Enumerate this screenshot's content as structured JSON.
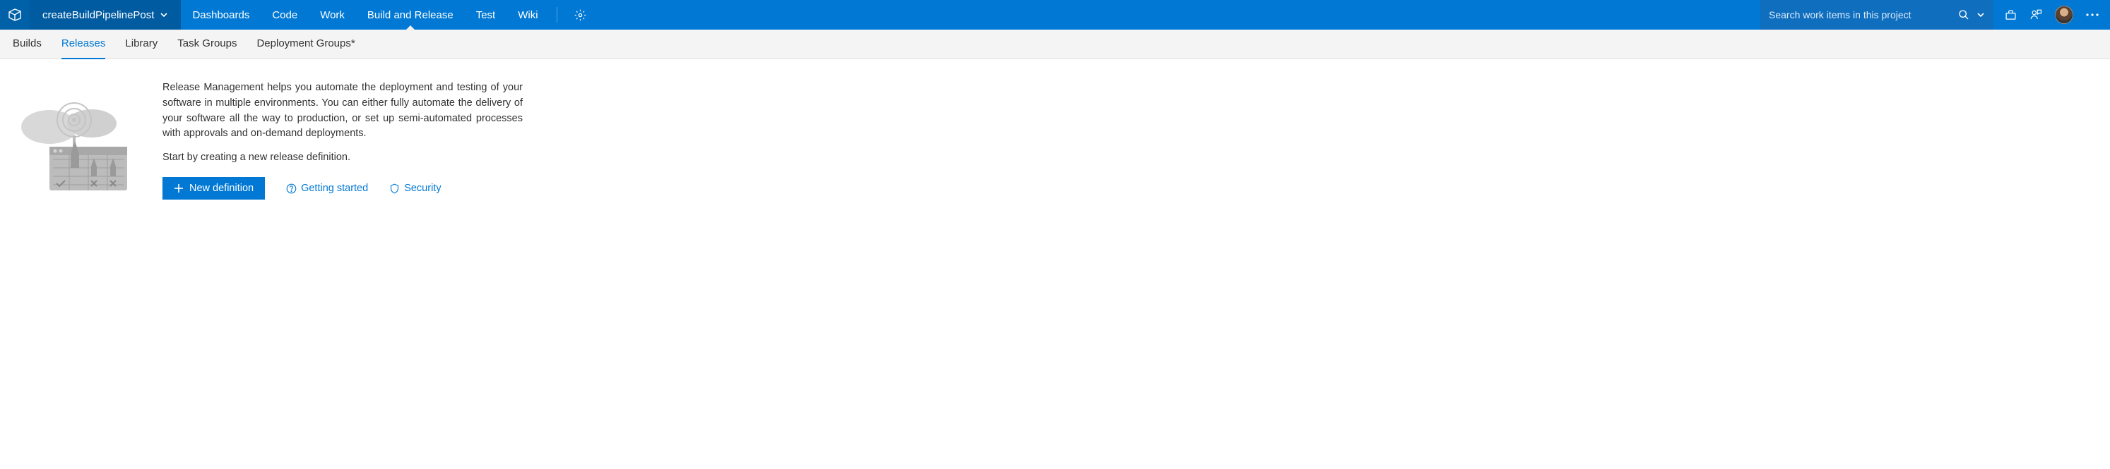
{
  "header": {
    "project_name": "createBuildPipelinePost",
    "nav": [
      "Dashboards",
      "Code",
      "Work",
      "Build and Release",
      "Test",
      "Wiki"
    ],
    "active_nav_index": 3,
    "search_placeholder": "Search work items in this project"
  },
  "subnav": {
    "items": [
      "Builds",
      "Releases",
      "Library",
      "Task Groups",
      "Deployment Groups*"
    ],
    "active_index": 1
  },
  "content": {
    "description": "Release Management helps you automate the deployment and testing of your software in multiple environments. You can either fully automate the delivery of your software all the way to production, or set up semi-automated processes with approvals and on-demand deployments.",
    "start_line": "Start by creating a new release definition.",
    "new_definition_label": "New definition",
    "getting_started_label": "Getting started",
    "security_label": "Security"
  }
}
